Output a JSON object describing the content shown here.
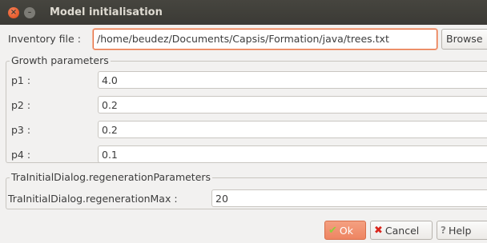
{
  "window": {
    "title": "Model initialisation",
    "close_glyph": "×",
    "minimize_glyph": "–"
  },
  "inventory": {
    "label": "Inventory file :",
    "value": "/home/beudez/Documents/Capsis/Formation/java/trees.txt",
    "browse_label": "Browse"
  },
  "growth": {
    "title": "Growth parameters",
    "rows": [
      {
        "label": "p1 :",
        "value": "4.0"
      },
      {
        "label": "p2 :",
        "value": "0.2"
      },
      {
        "label": "p3 :",
        "value": "0.2"
      },
      {
        "label": "p4 :",
        "value": "0.1"
      }
    ]
  },
  "regeneration": {
    "title": "TraInitialDialog.regenerationParameters",
    "label": "TraInitialDialog.regenerationMax :",
    "value": "20"
  },
  "buttons": {
    "ok": {
      "label": "Ok",
      "icon": "checkmark-icon",
      "glyph": "✔"
    },
    "cancel": {
      "label": "Cancel",
      "icon": "cross-icon",
      "glyph": "✖"
    },
    "help": {
      "label": "Help",
      "icon": "help-book-icon",
      "glyph": "?"
    }
  },
  "colors": {
    "accent": "#e76d3f",
    "titlebar": "#3b3a35",
    "ok_button": "#ee8562"
  }
}
